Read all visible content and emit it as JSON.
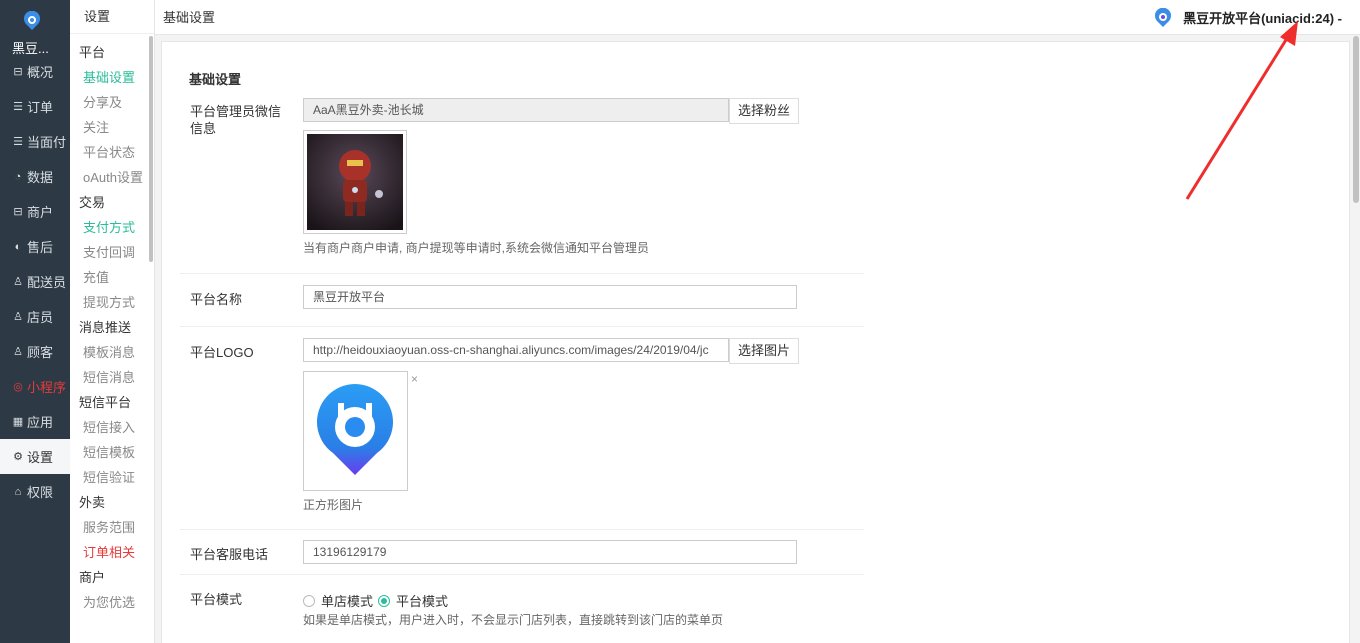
{
  "app": {
    "brand": "黑豆...",
    "logo_icon": "bean-logo-icon"
  },
  "nav": {
    "items": [
      {
        "label": "概况",
        "icon": "overview-icon",
        "glyph": "⊟"
      },
      {
        "label": "订单",
        "icon": "order-icon",
        "glyph": "☰"
      },
      {
        "label": "当面付",
        "icon": "pay-icon",
        "glyph": "☰"
      },
      {
        "label": "数据",
        "icon": "data-icon",
        "glyph": "◔"
      },
      {
        "label": "商户",
        "icon": "store-icon",
        "glyph": "⊟"
      },
      {
        "label": "售后",
        "icon": "aftersale-icon",
        "glyph": "◐"
      },
      {
        "label": "配送员",
        "icon": "courier-icon",
        "glyph": "♙"
      },
      {
        "label": "店员",
        "icon": "clerk-icon",
        "glyph": "♙"
      },
      {
        "label": "顾客",
        "icon": "customer-icon",
        "glyph": "♙"
      },
      {
        "label": "小程序",
        "icon": "miniapp-icon",
        "glyph": "◎"
      },
      {
        "label": "应用",
        "icon": "apps-icon",
        "glyph": "▦"
      },
      {
        "label": "设置",
        "icon": "gear-icon",
        "glyph": "⚙"
      },
      {
        "label": "权限",
        "icon": "lock-icon",
        "glyph": "⌂"
      }
    ]
  },
  "subnav": {
    "title": "设置",
    "groups": [
      {
        "label": "平台",
        "items": [
          "基础设置",
          "分享及关注",
          "平台状态",
          "oAuth设置"
        ]
      },
      {
        "label": "交易",
        "items": [
          "支付方式",
          "支付回调",
          "充值",
          "提现方式"
        ]
      },
      {
        "label": "消息推送",
        "items": [
          "模板消息",
          "短信消息"
        ]
      },
      {
        "label": "短信平台",
        "items": [
          "短信接入",
          "短信模板",
          "短信验证"
        ]
      },
      {
        "label": "外卖",
        "items": [
          "服务范围",
          "订单相关"
        ]
      },
      {
        "label": "商户",
        "items": [
          "为您优选"
        ]
      }
    ]
  },
  "header": {
    "title": "基础设置",
    "account": "黑豆开放平台(uniacid:24) -"
  },
  "form": {
    "section_title": "基础设置",
    "admin": {
      "label": "平台管理员微信信息",
      "value": "AaA黑豆外卖-池长城",
      "button": "选择粉丝",
      "help": "当有商户商户申请, 商户提现等申请时,系统会微信通知平台管理员"
    },
    "name": {
      "label": "平台名称",
      "value": "黑豆开放平台"
    },
    "logo": {
      "label": "平台LOGO",
      "value": "http://heidouxiaoyuan.oss-cn-shanghai.aliyuncs.com/images/24/2019/04/jc",
      "button": "选择图片",
      "remove": "×",
      "help": "正方形图片"
    },
    "phone": {
      "label": "平台客服电话",
      "value": "13196129179"
    },
    "mode": {
      "label": "平台模式",
      "options": [
        "单店模式",
        "平台模式"
      ],
      "selected": "平台模式",
      "help": "如果是单店模式，用户进入时，不会显示门店列表，直接跳转到该门店的菜单页"
    }
  },
  "colors": {
    "sidebar": "#2d3a45",
    "accent": "#2cbc9a",
    "danger": "#e63a3a",
    "logo_blue": "#1e90ff",
    "logo_purple": "#6a4cf0"
  }
}
